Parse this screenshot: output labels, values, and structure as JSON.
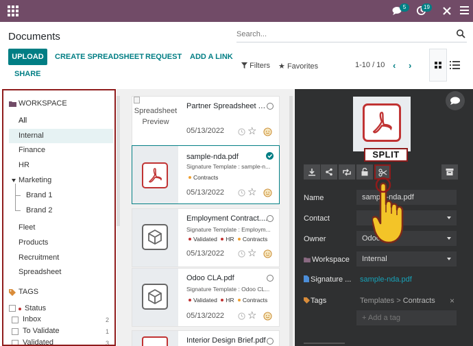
{
  "navbar": {
    "messages_count": "5",
    "activities_count": "19"
  },
  "header": {
    "title": "Documents",
    "search_placeholder": "Search..."
  },
  "actions": {
    "upload": "UPLOAD",
    "create_spreadsheet": "CREATE SPREADSHEET",
    "request": "REQUEST",
    "add_link": "ADD A LINK",
    "share": "SHARE",
    "filters": "Filters",
    "favorites": "Favorites",
    "pager": "1-10 / 10"
  },
  "sidebar": {
    "workspace_heading": "WORKSPACE",
    "items": [
      "All",
      "Internal",
      "Finance",
      "HR",
      "Marketing",
      "Brand 1",
      "Brand 2",
      "Fleet",
      "Products",
      "Recruitment",
      "Spreadsheet"
    ],
    "tags_heading": "TAGS",
    "status_label": "Status",
    "statuses": [
      {
        "label": "Inbox",
        "count": "2"
      },
      {
        "label": "To Validate",
        "count": "1"
      },
      {
        "label": "Validated",
        "count": "3"
      }
    ]
  },
  "cards": [
    {
      "title": "Partner Spreadsheet T...",
      "preview_alt": "Spreadsheet Preview",
      "date": "05/13/2022"
    },
    {
      "title": "sample-nda.pdf",
      "subtitle": "Signature Template : sample-n...",
      "tags": [
        "Contracts"
      ],
      "date": "05/13/2022"
    },
    {
      "title": "Employment Contract....",
      "subtitle": "Signature Template : Employm...",
      "tags": [
        "Validated",
        "HR",
        "Contracts"
      ],
      "date": "05/13/2022"
    },
    {
      "title": "Odoo CLA.pdf",
      "subtitle": "Signature Template : Odoo CL...",
      "tags": [
        "Validated",
        "HR",
        "Contracts"
      ],
      "date": "05/13/2022"
    },
    {
      "title": "Interior Design Brief.pdf"
    }
  ],
  "details": {
    "split_label": "SPLIT",
    "name_label": "Name",
    "name_value": "sample-nda.pdf",
    "contact_label": "Contact",
    "owner_label": "Owner",
    "owner_value": "Odoo",
    "workspace_label": "Workspace",
    "workspace_value": "Internal",
    "signature_label": "Signature ...",
    "signature_value": "sample-nda.pdf",
    "tags_label": "Tags",
    "tags_value_1": "Templates",
    "tags_value_2": "Contracts",
    "add_tag_placeholder": "+ Add a tag",
    "tag_remove": "×"
  },
  "colors": {
    "navbar": "#714b67",
    "accent": "#017e84",
    "panel_dark": "#2f3031",
    "highlight_border": "#8f1b1b",
    "pdf_red": "#c03232"
  }
}
